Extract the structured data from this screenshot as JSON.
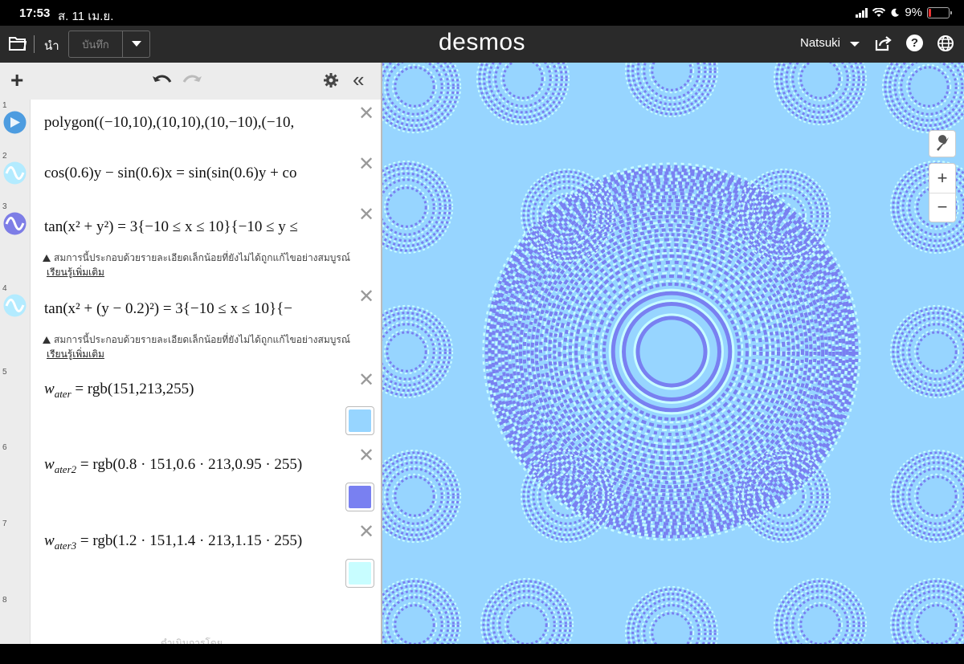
{
  "status": {
    "time": "17:53",
    "date": "ส. 11 เม.ย.",
    "battery": "9%"
  },
  "header": {
    "import_label": "นำ",
    "save_label": "บันทึก",
    "logo": "desmos",
    "user": "Natsuki"
  },
  "expressions": [
    {
      "num": "1",
      "type": "polygon",
      "latex": "polygon((−10,10),(10,10),(10,−10),(−10,",
      "color": "#4d9ce0"
    },
    {
      "num": "2",
      "type": "implicit",
      "latex_a": "cos(0.6)y − sin(0.6)x",
      "latex_b": "sin(sin(0.6)y + co",
      "color": "#b3ebff"
    },
    {
      "num": "3",
      "type": "implicit",
      "latex": "tan(x² + y²) = 3{−10 ≤ x ≤ 10}{−10 ≤ y ≤",
      "warning": "สมการนี้ประกอบด้วยรายละเอียดเล็กน้อยที่ยังไม่ได้ถูกแก้ไขอย่างสมบูรณ์",
      "learn_more": "เรียนรู้เพิ่มเติม",
      "color": "#7d7de6"
    },
    {
      "num": "4",
      "type": "implicit",
      "latex": "tan(x² + (y − 0.2)²) = 3{−10 ≤ x ≤ 10}{−",
      "warning": "สมการนี้ประกอบด้วยรายละเอียดเล็กน้อยที่ยังไม่ได้ถูกแก้ไขอย่างสมบูรณ์",
      "learn_more": "เรียนรู้เพิ่มเติม",
      "color": "#b3ebff"
    },
    {
      "num": "5",
      "type": "color",
      "name": "w",
      "sub": "ater",
      "rhs": " = rgb(151,213,255)",
      "swatch": "#97d5ff"
    },
    {
      "num": "6",
      "type": "color",
      "name": "w",
      "sub": "ater2",
      "rhs": " = rgb(0.8 · 151,0.6 · 213,0.95 · 255)",
      "swatch": "#7980f1"
    },
    {
      "num": "7",
      "type": "color",
      "name": "w",
      "sub": "ater3",
      "rhs": " = rgb(1.2 · 151,1.4 · 213,1.15 · 255)",
      "swatch": "#c8fdff"
    },
    {
      "num": "8",
      "type": "empty"
    }
  ],
  "footer_note": "ดำเนินการโดย",
  "graph": {
    "bg": "#97d5ff",
    "dark": "#7980f1",
    "light": "#c8fdff"
  }
}
